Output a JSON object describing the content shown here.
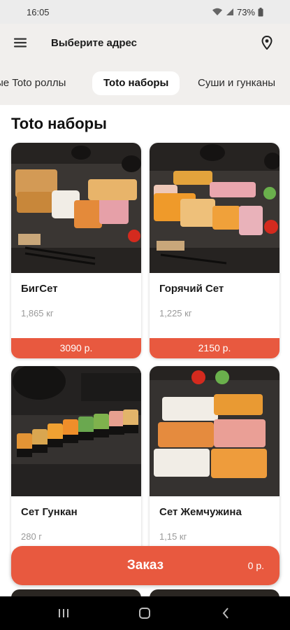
{
  "status_bar": {
    "time": "16:05",
    "battery": "73%",
    "icons": [
      "wifi-icon",
      "signal-icon",
      "battery-icon"
    ]
  },
  "header": {
    "menu_icon": "hamburger-menu-icon",
    "address_title": "Выберите адрес",
    "location_icon": "location-pin-icon"
  },
  "tabs": [
    {
      "label": "ые Toto роллы",
      "active": false
    },
    {
      "label": "Toto наборы",
      "active": true
    },
    {
      "label": "Суши и гунканы",
      "active": false
    }
  ],
  "section": {
    "title": "Toto наборы"
  },
  "products": [
    {
      "name": "БигСет",
      "weight": "1,865 кг",
      "price": "3090 р."
    },
    {
      "name": "Горячий Сет",
      "weight": "1,225 кг",
      "price": "2150 р."
    },
    {
      "name": "Сет Гункан",
      "weight": "280 г",
      "price": ""
    },
    {
      "name": "Сет Жемчужина",
      "weight": "1,15 кг",
      "price": ""
    }
  ],
  "order_bar": {
    "label": "Заказ",
    "total": "0 р."
  },
  "nav_bar": {
    "icons": [
      "recent-apps-icon",
      "home-icon",
      "back-icon"
    ]
  },
  "colors": {
    "accent": "#e8593f",
    "header_bg": "#f1efed",
    "photo_bg": "#2a2826"
  }
}
